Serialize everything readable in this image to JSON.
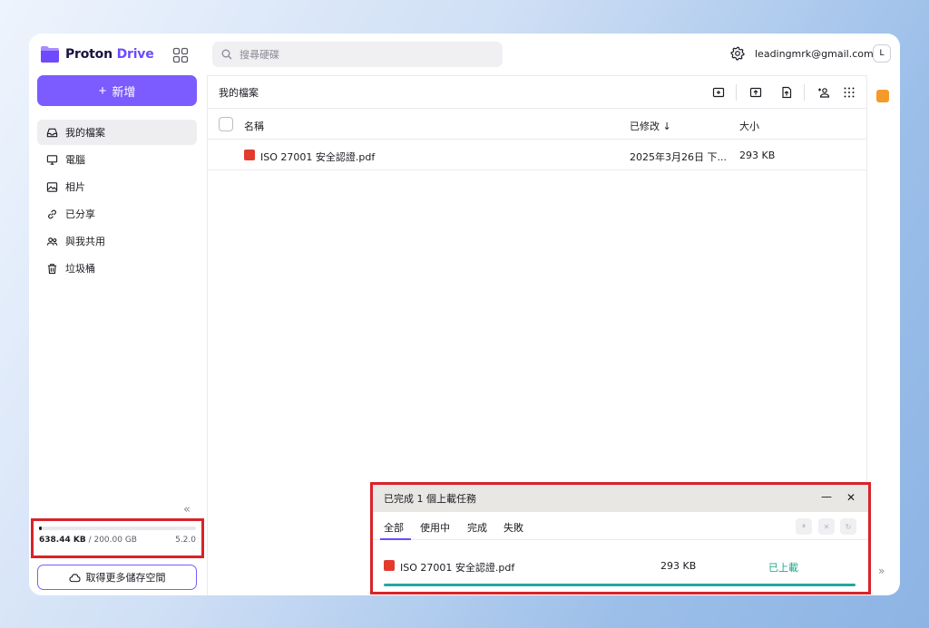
{
  "app": {
    "logo_text": "Proton",
    "logo_accent": "Drive",
    "brand_color": "#6d4aff"
  },
  "sidebar": {
    "new_label": "新增",
    "items": [
      {
        "label": "我的檔案",
        "icon": "inbox-icon",
        "active": true
      },
      {
        "label": "電腦",
        "icon": "monitor-icon"
      },
      {
        "label": "相片",
        "icon": "image-icon"
      },
      {
        "label": "已分享",
        "icon": "link-icon"
      },
      {
        "label": "與我共用",
        "icon": "users-icon"
      },
      {
        "label": "垃圾桶",
        "icon": "trash-icon"
      }
    ],
    "storage": {
      "used": "638.44 KB",
      "separator": " / ",
      "total": "200.00 GB",
      "version": "5.2.0",
      "used_fraction": 0.02
    },
    "more_storage_label": "取得更多儲存空間"
  },
  "header": {
    "search_placeholder": "搜尋硬碟",
    "email": "leadingmrk@gmail.com",
    "avatar_initial": "L"
  },
  "main": {
    "title": "我的檔案",
    "columns": {
      "name": "名稱",
      "modified": "已修改",
      "size": "大小"
    },
    "files": [
      {
        "name": "ISO 27001 安全認證.pdf",
        "modified": "2025年3月26日 下...",
        "size": "293 KB"
      }
    ]
  },
  "transfer": {
    "title": "已完成 1 個上載任務",
    "tabs": [
      "全部",
      "使用中",
      "完成",
      "失敗"
    ],
    "items": [
      {
        "name": "ISO 27001 安全認證.pdf",
        "size": "293 KB",
        "status": "已上載",
        "progress": 1.0
      }
    ],
    "status_color": "#1ea885"
  }
}
